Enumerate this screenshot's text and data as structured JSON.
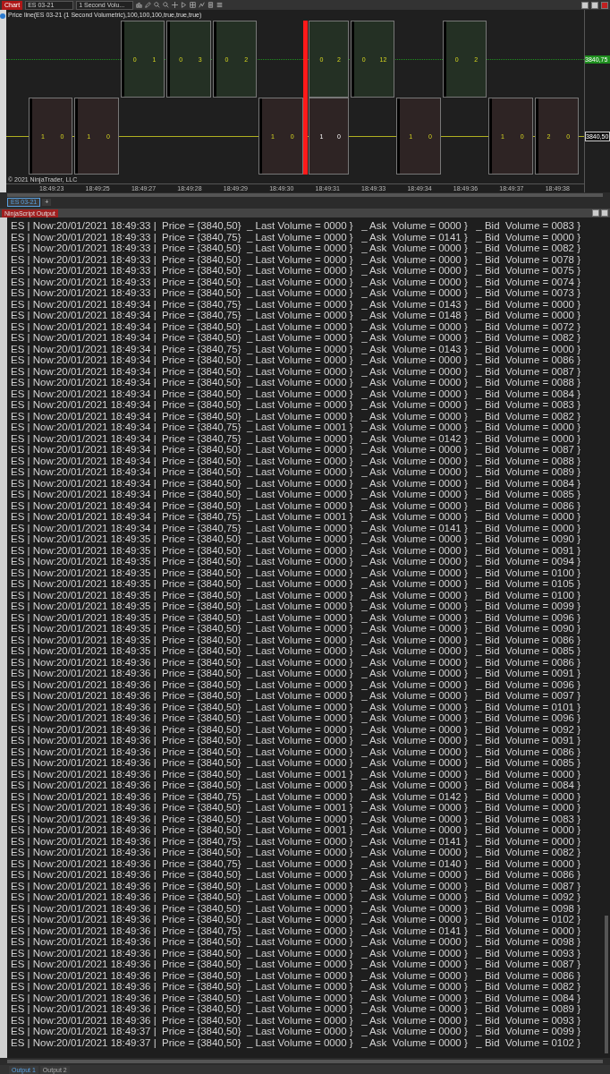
{
  "window": {
    "title": "Chart"
  },
  "toolbar": {
    "instrument": "ES 03-21",
    "interval": "1 Second Volu..."
  },
  "chart": {
    "title": "Price line(ES 03-21 (1 Second Volumetric),100,100,100,true,true,true)",
    "copyright": "© 2021 NinjaTrader, LLC",
    "prices": [
      {
        "label": "3840,75",
        "kind": "ask"
      },
      {
        "label": "3840,50",
        "kind": "bid"
      }
    ],
    "bars": [
      {
        "time": "18:49:23",
        "lower": [
          "1",
          "0"
        ],
        "current": false
      },
      {
        "time": "18:49:25",
        "lower": [
          "1",
          "0"
        ],
        "current": false
      },
      {
        "time": "18:49:27",
        "upper": [
          "0",
          "1"
        ],
        "current": false
      },
      {
        "time": "18:49:28",
        "upper": [
          "0",
          "3"
        ],
        "current": false
      },
      {
        "time": "18:49:29",
        "upper": [
          "0",
          "2"
        ],
        "current": false
      },
      {
        "time": "18:49:30",
        "lower": [
          "1",
          "0"
        ],
        "current": false
      },
      {
        "time": "18:49:31",
        "upper": [
          "0",
          "2"
        ],
        "lower": [
          "1",
          "0"
        ],
        "current": true
      },
      {
        "time": "18:49:33",
        "upper": [
          "0",
          "12"
        ],
        "current": false
      },
      {
        "time": "18:49:34",
        "lower": [
          "1",
          "0"
        ],
        "current": false
      },
      {
        "time": "18:49:36",
        "upper": [
          "0",
          "2"
        ],
        "current": false
      },
      {
        "time": "18:49:37",
        "lower": [
          "1",
          "0"
        ],
        "current": false
      },
      {
        "time": "18:49:38",
        "lower": [
          "2",
          "0"
        ],
        "current": false
      }
    ]
  },
  "chart_tabs": [
    {
      "label": "ES 03-21",
      "selected": true
    },
    {
      "label": "+",
      "selected": false
    }
  ],
  "output": {
    "title": "NinjaScript Output",
    "lines": [
      "ES | Now:20/01/2021 18:49:33 |  Price = {3840,50}  _ Last Volume = 0000 }   _ Ask  Volume = 0000 }   _ Bid  Volume = 0083 }",
      "ES | Now:20/01/2021 18:49:33 |  Price = {3840,75}  _ Last Volume = 0000 }   _ Ask  Volume = 0141 }   _ Bid  Volume = 0000 }",
      "ES | Now:20/01/2021 18:49:33 |  Price = {3840,50}  _ Last Volume = 0000 }   _ Ask  Volume = 0000 }   _ Bid  Volume = 0082 }",
      "ES | Now:20/01/2021 18:49:33 |  Price = {3840,50}  _ Last Volume = 0000 }   _ Ask  Volume = 0000 }   _ Bid  Volume = 0078 }",
      "ES | Now:20/01/2021 18:49:33 |  Price = {3840,50}  _ Last Volume = 0000 }   _ Ask  Volume = 0000 }   _ Bid  Volume = 0075 }",
      "ES | Now:20/01/2021 18:49:33 |  Price = {3840,50}  _ Last Volume = 0000 }   _ Ask  Volume = 0000 }   _ Bid  Volume = 0074 }",
      "ES | Now:20/01/2021 18:49:33 |  Price = {3840,50}  _ Last Volume = 0000 }   _ Ask  Volume = 0000 }   _ Bid  Volume = 0073 }",
      "ES | Now:20/01/2021 18:49:34 |  Price = {3840,75}  _ Last Volume = 0000 }   _ Ask  Volume = 0143 }   _ Bid  Volume = 0000 }",
      "ES | Now:20/01/2021 18:49:34 |  Price = {3840,75}  _ Last Volume = 0000 }   _ Ask  Volume = 0148 }   _ Bid  Volume = 0000 }",
      "ES | Now:20/01/2021 18:49:34 |  Price = {3840,50}  _ Last Volume = 0000 }   _ Ask  Volume = 0000 }   _ Bid  Volume = 0072 }",
      "ES | Now:20/01/2021 18:49:34 |  Price = {3840,50}  _ Last Volume = 0000 }   _ Ask  Volume = 0000 }   _ Bid  Volume = 0082 }",
      "ES | Now:20/01/2021 18:49:34 |  Price = {3840,75}  _ Last Volume = 0000 }   _ Ask  Volume = 0143 }   _ Bid  Volume = 0000 }",
      "ES | Now:20/01/2021 18:49:34 |  Price = {3840,50}  _ Last Volume = 0000 }   _ Ask  Volume = 0000 }   _ Bid  Volume = 0086 }",
      "ES | Now:20/01/2021 18:49:34 |  Price = {3840,50}  _ Last Volume = 0000 }   _ Ask  Volume = 0000 }   _ Bid  Volume = 0087 }",
      "ES | Now:20/01/2021 18:49:34 |  Price = {3840,50}  _ Last Volume = 0000 }   _ Ask  Volume = 0000 }   _ Bid  Volume = 0088 }",
      "ES | Now:20/01/2021 18:49:34 |  Price = {3840,50}  _ Last Volume = 0000 }   _ Ask  Volume = 0000 }   _ Bid  Volume = 0084 }",
      "ES | Now:20/01/2021 18:49:34 |  Price = {3840,50}  _ Last Volume = 0000 }   _ Ask  Volume = 0000 }   _ Bid  Volume = 0083 }",
      "ES | Now:20/01/2021 18:49:34 |  Price = {3840,50}  _ Last Volume = 0000 }   _ Ask  Volume = 0000 }   _ Bid  Volume = 0082 }",
      "ES | Now:20/01/2021 18:49:34 |  Price = {3840,75}  _ Last Volume = 0001 }   _ Ask  Volume = 0000 }   _ Bid  Volume = 0000 }",
      "ES | Now:20/01/2021 18:49:34 |  Price = {3840,75}  _ Last Volume = 0000 }   _ Ask  Volume = 0142 }   _ Bid  Volume = 0000 }",
      "ES | Now:20/01/2021 18:49:34 |  Price = {3840,50}  _ Last Volume = 0000 }   _ Ask  Volume = 0000 }   _ Bid  Volume = 0087 }",
      "ES | Now:20/01/2021 18:49:34 |  Price = {3840,50}  _ Last Volume = 0000 }   _ Ask  Volume = 0000 }   _ Bid  Volume = 0088 }",
      "ES | Now:20/01/2021 18:49:34 |  Price = {3840,50}  _ Last Volume = 0000 }   _ Ask  Volume = 0000 }   _ Bid  Volume = 0089 }",
      "ES | Now:20/01/2021 18:49:34 |  Price = {3840,50}  _ Last Volume = 0000 }   _ Ask  Volume = 0000 }   _ Bid  Volume = 0084 }",
      "ES | Now:20/01/2021 18:49:34 |  Price = {3840,50}  _ Last Volume = 0000 }   _ Ask  Volume = 0000 }   _ Bid  Volume = 0085 }",
      "ES | Now:20/01/2021 18:49:34 |  Price = {3840,50}  _ Last Volume = 0000 }   _ Ask  Volume = 0000 }   _ Bid  Volume = 0086 }",
      "ES | Now:20/01/2021 18:49:34 |  Price = {3840,75}  _ Last Volume = 0001 }   _ Ask  Volume = 0000 }   _ Bid  Volume = 0000 }",
      "ES | Now:20/01/2021 18:49:34 |  Price = {3840,75}  _ Last Volume = 0000 }   _ Ask  Volume = 0141 }   _ Bid  Volume = 0000 }",
      "ES | Now:20/01/2021 18:49:35 |  Price = {3840,50}  _ Last Volume = 0000 }   _ Ask  Volume = 0000 }   _ Bid  Volume = 0090 }",
      "ES | Now:20/01/2021 18:49:35 |  Price = {3840,50}  _ Last Volume = 0000 }   _ Ask  Volume = 0000 }   _ Bid  Volume = 0091 }",
      "ES | Now:20/01/2021 18:49:35 |  Price = {3840,50}  _ Last Volume = 0000 }   _ Ask  Volume = 0000 }   _ Bid  Volume = 0094 }",
      "ES | Now:20/01/2021 18:49:35 |  Price = {3840,50}  _ Last Volume = 0000 }   _ Ask  Volume = 0000 }   _ Bid  Volume = 0100 }",
      "ES | Now:20/01/2021 18:49:35 |  Price = {3840,50}  _ Last Volume = 0000 }   _ Ask  Volume = 0000 }   _ Bid  Volume = 0105 }",
      "ES | Now:20/01/2021 18:49:35 |  Price = {3840,50}  _ Last Volume = 0000 }   _ Ask  Volume = 0000 }   _ Bid  Volume = 0100 }",
      "ES | Now:20/01/2021 18:49:35 |  Price = {3840,50}  _ Last Volume = 0000 }   _ Ask  Volume = 0000 }   _ Bid  Volume = 0099 }",
      "ES | Now:20/01/2021 18:49:35 |  Price = {3840,50}  _ Last Volume = 0000 }   _ Ask  Volume = 0000 }   _ Bid  Volume = 0096 }",
      "ES | Now:20/01/2021 18:49:35 |  Price = {3840,50}  _ Last Volume = 0000 }   _ Ask  Volume = 0000 }   _ Bid  Volume = 0090 }",
      "ES | Now:20/01/2021 18:49:35 |  Price = {3840,50}  _ Last Volume = 0000 }   _ Ask  Volume = 0000 }   _ Bid  Volume = 0086 }",
      "ES | Now:20/01/2021 18:49:35 |  Price = {3840,50}  _ Last Volume = 0000 }   _ Ask  Volume = 0000 }   _ Bid  Volume = 0085 }",
      "ES | Now:20/01/2021 18:49:36 |  Price = {3840,50}  _ Last Volume = 0000 }   _ Ask  Volume = 0000 }   _ Bid  Volume = 0086 }",
      "ES | Now:20/01/2021 18:49:36 |  Price = {3840,50}  _ Last Volume = 0000 }   _ Ask  Volume = 0000 }   _ Bid  Volume = 0091 }",
      "ES | Now:20/01/2021 18:49:36 |  Price = {3840,50}  _ Last Volume = 0000 }   _ Ask  Volume = 0000 }   _ Bid  Volume = 0096 }",
      "ES | Now:20/01/2021 18:49:36 |  Price = {3840,50}  _ Last Volume = 0000 }   _ Ask  Volume = 0000 }   _ Bid  Volume = 0097 }",
      "ES | Now:20/01/2021 18:49:36 |  Price = {3840,50}  _ Last Volume = 0000 }   _ Ask  Volume = 0000 }   _ Bid  Volume = 0101 }",
      "ES | Now:20/01/2021 18:49:36 |  Price = {3840,50}  _ Last Volume = 0000 }   _ Ask  Volume = 0000 }   _ Bid  Volume = 0096 }",
      "ES | Now:20/01/2021 18:49:36 |  Price = {3840,50}  _ Last Volume = 0000 }   _ Ask  Volume = 0000 }   _ Bid  Volume = 0092 }",
      "ES | Now:20/01/2021 18:49:36 |  Price = {3840,50}  _ Last Volume = 0000 }   _ Ask  Volume = 0000 }   _ Bid  Volume = 0091 }",
      "ES | Now:20/01/2021 18:49:36 |  Price = {3840,50}  _ Last Volume = 0000 }   _ Ask  Volume = 0000 }   _ Bid  Volume = 0086 }",
      "ES | Now:20/01/2021 18:49:36 |  Price = {3840,50}  _ Last Volume = 0000 }   _ Ask  Volume = 0000 }   _ Bid  Volume = 0085 }",
      "ES | Now:20/01/2021 18:49:36 |  Price = {3840,50}  _ Last Volume = 0001 }   _ Ask  Volume = 0000 }   _ Bid  Volume = 0000 }",
      "ES | Now:20/01/2021 18:49:36 |  Price = {3840,50}  _ Last Volume = 0000 }   _ Ask  Volume = 0000 }   _ Bid  Volume = 0084 }",
      "ES | Now:20/01/2021 18:49:36 |  Price = {3840,75}  _ Last Volume = 0000 }   _ Ask  Volume = 0142 }   _ Bid  Volume = 0000 }",
      "ES | Now:20/01/2021 18:49:36 |  Price = {3840,50}  _ Last Volume = 0001 }   _ Ask  Volume = 0000 }   _ Bid  Volume = 0000 }",
      "ES | Now:20/01/2021 18:49:36 |  Price = {3840,50}  _ Last Volume = 0000 }   _ Ask  Volume = 0000 }   _ Bid  Volume = 0083 }",
      "ES | Now:20/01/2021 18:49:36 |  Price = {3840,50}  _ Last Volume = 0001 }   _ Ask  Volume = 0000 }   _ Bid  Volume = 0000 }",
      "ES | Now:20/01/2021 18:49:36 |  Price = {3840,75}  _ Last Volume = 0000 }   _ Ask  Volume = 0141 }   _ Bid  Volume = 0000 }",
      "ES | Now:20/01/2021 18:49:36 |  Price = {3840,50}  _ Last Volume = 0000 }   _ Ask  Volume = 0000 }   _ Bid  Volume = 0082 }",
      "ES | Now:20/01/2021 18:49:36 |  Price = {3840,75}  _ Last Volume = 0000 }   _ Ask  Volume = 0140 }   _ Bid  Volume = 0000 }",
      "ES | Now:20/01/2021 18:49:36 |  Price = {3840,50}  _ Last Volume = 0000 }   _ Ask  Volume = 0000 }   _ Bid  Volume = 0086 }",
      "ES | Now:20/01/2021 18:49:36 |  Price = {3840,50}  _ Last Volume = 0000 }   _ Ask  Volume = 0000 }   _ Bid  Volume = 0087 }",
      "ES | Now:20/01/2021 18:49:36 |  Price = {3840,50}  _ Last Volume = 0000 }   _ Ask  Volume = 0000 }   _ Bid  Volume = 0092 }",
      "ES | Now:20/01/2021 18:49:36 |  Price = {3840,50}  _ Last Volume = 0000 }   _ Ask  Volume = 0000 }   _ Bid  Volume = 0098 }",
      "ES | Now:20/01/2021 18:49:36 |  Price = {3840,50}  _ Last Volume = 0000 }   _ Ask  Volume = 0000 }   _ Bid  Volume = 0102 }",
      "ES | Now:20/01/2021 18:49:36 |  Price = {3840,75}  _ Last Volume = 0000 }   _ Ask  Volume = 0141 }   _ Bid  Volume = 0000 }",
      "ES | Now:20/01/2021 18:49:36 |  Price = {3840,50}  _ Last Volume = 0000 }   _ Ask  Volume = 0000 }   _ Bid  Volume = 0098 }",
      "ES | Now:20/01/2021 18:49:36 |  Price = {3840,50}  _ Last Volume = 0000 }   _ Ask  Volume = 0000 }   _ Bid  Volume = 0093 }",
      "ES | Now:20/01/2021 18:49:36 |  Price = {3840,50}  _ Last Volume = 0000 }   _ Ask  Volume = 0000 }   _ Bid  Volume = 0087 }",
      "ES | Now:20/01/2021 18:49:36 |  Price = {3840,50}  _ Last Volume = 0000 }   _ Ask  Volume = 0000 }   _ Bid  Volume = 0086 }",
      "ES | Now:20/01/2021 18:49:36 |  Price = {3840,50}  _ Last Volume = 0000 }   _ Ask  Volume = 0000 }   _ Bid  Volume = 0082 }",
      "ES | Now:20/01/2021 18:49:36 |  Price = {3840,50}  _ Last Volume = 0000 }   _ Ask  Volume = 0000 }   _ Bid  Volume = 0084 }",
      "ES | Now:20/01/2021 18:49:36 |  Price = {3840,50}  _ Last Volume = 0000 }   _ Ask  Volume = 0000 }   _ Bid  Volume = 0089 }",
      "ES | Now:20/01/2021 18:49:36 |  Price = {3840,50}  _ Last Volume = 0000 }   _ Ask  Volume = 0000 }   _ Bid  Volume = 0093 }",
      "ES | Now:20/01/2021 18:49:37 |  Price = {3840,50}  _ Last Volume = 0000 }   _ Ask  Volume = 0000 }   _ Bid  Volume = 0099 }",
      "ES | Now:20/01/2021 18:49:37 |  Price = {3840,50}  _ Last Volume = 0000 }   _ Ask  Volume = 0000 }   _ Bid  Volume = 0102 }"
    ]
  },
  "output_tabs": [
    {
      "label": "Output 1",
      "selected": true
    },
    {
      "label": "Output 2",
      "selected": false
    }
  ]
}
